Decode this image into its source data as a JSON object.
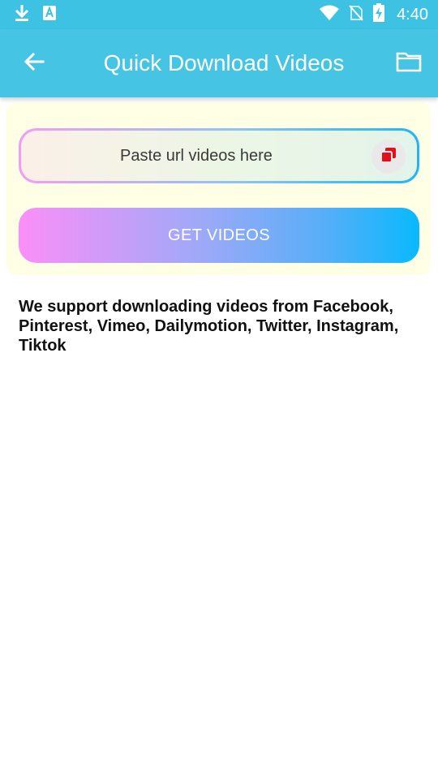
{
  "status_bar": {
    "time": "4:40",
    "icons": [
      "download-icon",
      "font-a-icon",
      "wifi-icon",
      "no-sim-icon",
      "battery-charging-icon"
    ]
  },
  "app_bar": {
    "title": "Quick Download Videos",
    "back_icon": "arrow-left-icon",
    "folder_icon": "folder-icon"
  },
  "url_input": {
    "placeholder": "Paste url videos here",
    "value": "",
    "paste_icon": "paste-icon"
  },
  "get_videos_button": {
    "label": "GET VIDEOS"
  },
  "support_text": "We support downloading videos from Facebook, Pinterest, Vimeo, Dailymotion, Twitter, Instagram, Tiktok",
  "colors": {
    "primary": "#45c4e4",
    "card_background": "#ffffe6",
    "paste_icon": "#e0101e"
  }
}
